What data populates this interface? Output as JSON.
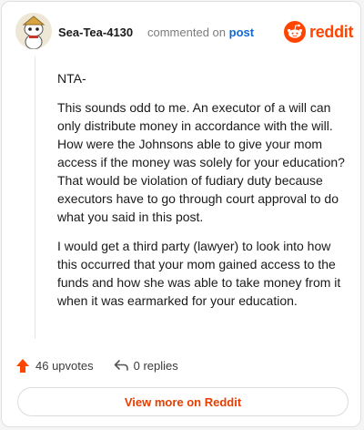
{
  "comment": {
    "username": "Sea-Tea-4130",
    "action_text": "commented on",
    "target_link": "post",
    "paragraphs": [
      "NTA-",
      "This sounds odd to me. An executor of a will can only distribute money in accordance with the will. How were the Johnsons able to give your mom access if the money was solely for your education? That would be violation of fudiary duty because executors have to go through court approval to do what you said in this post.",
      "I would get a third party (lawyer) to look into how this occurred that your mom gained access to the funds and how she was able to take money from it when it was earmarked for your education."
    ]
  },
  "brand": {
    "name": "reddit",
    "icon": "reddit-logo-icon",
    "color": "#ff4500"
  },
  "footer": {
    "upvotes_label": "46 upvotes",
    "upvote_icon": "upvote-arrow-icon",
    "replies_label": "0 replies",
    "reply_icon": "reply-arrow-icon"
  },
  "cta": {
    "label": "View more on Reddit",
    "color": "#e53e00"
  },
  "colors": {
    "link": "#0f6ad6",
    "accent": "#ff4500"
  }
}
